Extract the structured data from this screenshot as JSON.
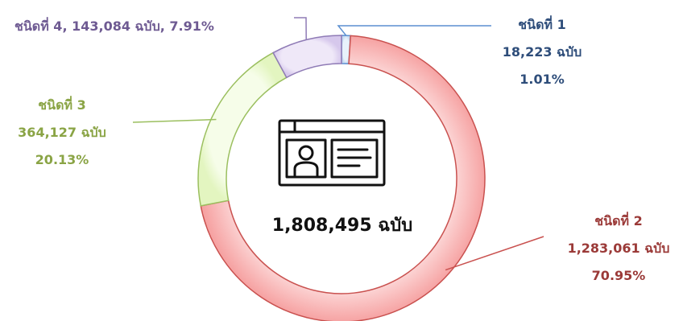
{
  "chart_data": {
    "type": "pie",
    "style": "donut",
    "total_label": "1,808,495 ฉบับ",
    "center_icon": "id-card-icon",
    "slices": [
      {
        "name": "ชนิดที่ 1",
        "value": 18223,
        "count_label": "18,223  ฉบับ",
        "percent_label": "1.01%",
        "fill": "#c9dcf2",
        "edge": "#5b8fd1",
        "text_color": "#2e4d7a"
      },
      {
        "name": "ชนิดที่ 2",
        "value": 1283061,
        "count_label": "1,283,061 ฉบับ",
        "percent_label": "70.95%",
        "fill": "#f8a9a9",
        "edge": "#c9514f",
        "text_color": "#9b3a38"
      },
      {
        "name": "ชนิดที่ 3",
        "value": 364127,
        "count_label": "364,127 ฉบับ",
        "percent_label": "20.13%",
        "fill": "#e8f8c8",
        "edge": "#9bbf5f",
        "text_color": "#8aa445"
      },
      {
        "name": "ชนิดที่ 4",
        "value": 143084,
        "inline_label": "ชนิดที่ 4,  143,084 ฉบับ, 7.91%",
        "fill": "#ddd0ef",
        "edge": "#8f7bb6",
        "text_color": "#6e5a92"
      }
    ]
  }
}
